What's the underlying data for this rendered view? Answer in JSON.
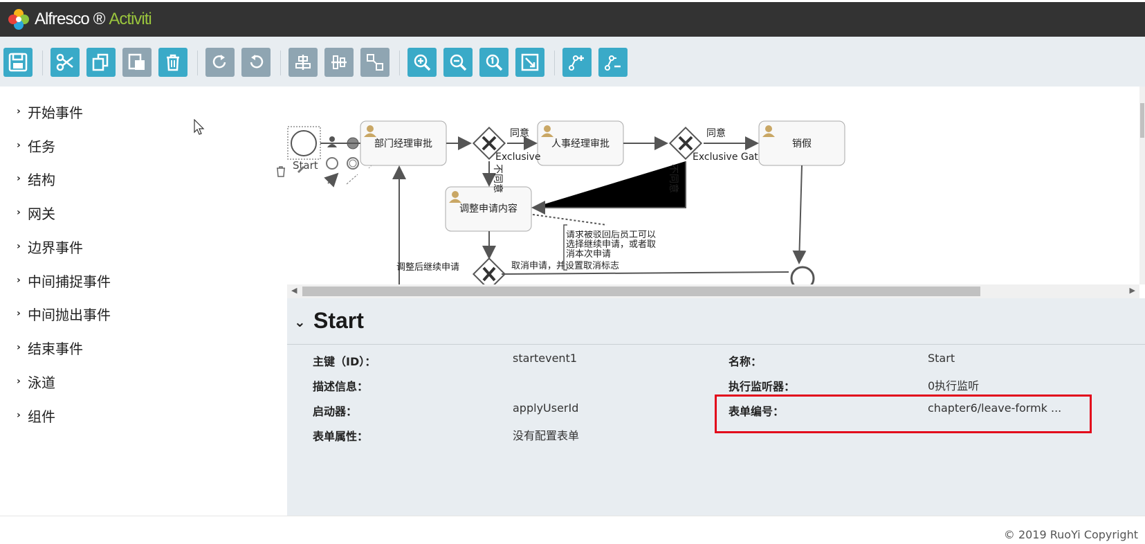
{
  "header": {
    "brand": "Alfresco",
    "product": "Activiti"
  },
  "toolbar": {
    "buttons": [
      {
        "name": "save",
        "icon": "save-icon"
      },
      {
        "name": "cut",
        "icon": "scissors-icon"
      },
      {
        "name": "copy",
        "icon": "copy-icon"
      },
      {
        "name": "paste",
        "icon": "paste-icon"
      },
      {
        "name": "delete",
        "icon": "trash-icon"
      },
      {
        "name": "redo",
        "icon": "redo-icon"
      },
      {
        "name": "undo",
        "icon": "undo-icon"
      },
      {
        "name": "align-vertical",
        "icon": "align-vertical-icon"
      },
      {
        "name": "align-horizontal",
        "icon": "align-horizontal-icon"
      },
      {
        "name": "same-size",
        "icon": "same-size-icon"
      },
      {
        "name": "zoom-in",
        "icon": "zoom-in-icon"
      },
      {
        "name": "zoom-out",
        "icon": "zoom-out-icon"
      },
      {
        "name": "zoom-actual",
        "icon": "zoom-actual-icon"
      },
      {
        "name": "zoom-fit",
        "icon": "zoom-fit-icon"
      },
      {
        "name": "add-bendpoint",
        "icon": "add-bendpoint-icon"
      },
      {
        "name": "remove-bendpoint",
        "icon": "remove-bendpoint-icon"
      }
    ]
  },
  "palette": {
    "items": [
      "开始事件",
      "任务",
      "结构",
      "网关",
      "边界事件",
      "中间捕捉事件",
      "中间抛出事件",
      "结束事件",
      "泳道",
      "组件"
    ]
  },
  "diagram": {
    "start_label": "Start",
    "task_dept": "部门经理审批",
    "task_hr": "人事经理审批",
    "task_leave": "销假",
    "task_adjust": "调整申请内容",
    "gateway1_label": "Exclusive",
    "gateway2_label": "Exclusive Gat",
    "flow_agree1": "同意",
    "flow_agree2": "同意",
    "flow_disagree1": "不同意",
    "flow_disagree2": "不同意",
    "flow_continue": "调整后继续申请",
    "flow_cancel": "取消申请，并设置取消标志",
    "annotation": "请求被驳回后员工可以选择继续申请，或者取消本次申请"
  },
  "properties": {
    "title": "Start",
    "fields": {
      "id_label": "主键（ID）：",
      "id_value": "startevent1",
      "name_label": "名称：",
      "name_value": "Start",
      "desc_label": "描述信息：",
      "desc_value": "",
      "listener_label": "执行监听器：",
      "listener_value": "0执行监听",
      "initiator_label": "启动器：",
      "initiator_value": "applyUserId",
      "formkey_label": "表单编号：",
      "formkey_value": "chapter6/leave-formk ...",
      "formprops_label": "表单属性：",
      "formprops_value": "没有配置表单"
    }
  },
  "footer": {
    "copyright": "© 2019 RuoYi Copyright"
  },
  "colors": {
    "header_bg": "#333333",
    "toolbar_button": "#3aaac8",
    "toolbar_button_disabled": "#8fa5b2",
    "panel_bg": "#e8edf1",
    "highlight": "#e2061b",
    "brand_green": "#9ac53d"
  }
}
